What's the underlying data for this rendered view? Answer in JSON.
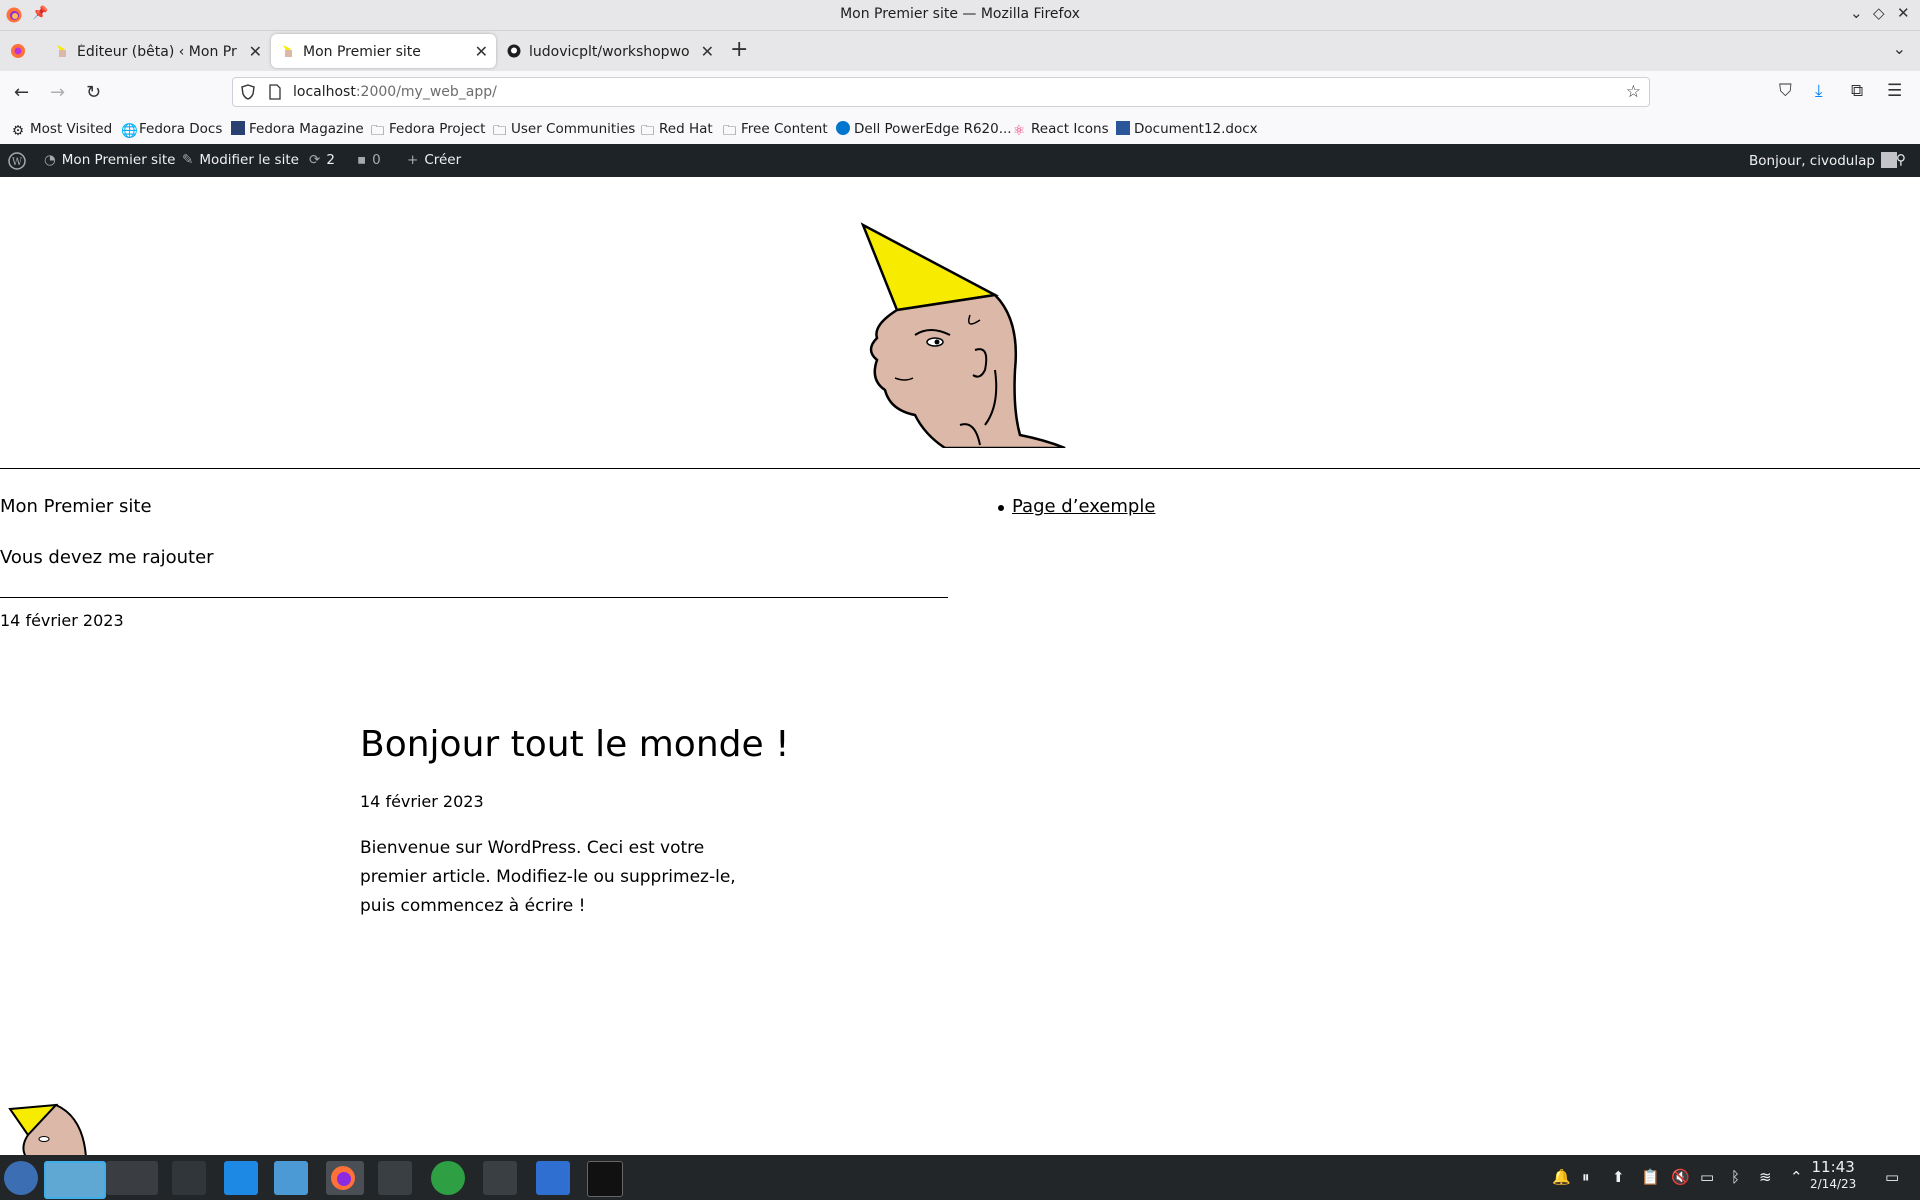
{
  "window": {
    "title": "Mon Premier site — Mozilla Firefox",
    "pin_icon": "pin-icon",
    "controls": [
      "minimize-icon",
      "maximize-icon",
      "close-icon"
    ]
  },
  "tabs": [
    {
      "label": "Éditeur (bêta) ‹ Mon Premi",
      "close": "✕",
      "active": false
    },
    {
      "label": "Mon Premier site",
      "close": "✕",
      "active": true
    },
    {
      "label": "ludovicplt/workshopwordp",
      "close": "✕",
      "active": false
    }
  ],
  "tabbar": {
    "new_tab": "+",
    "list_all": "⌄"
  },
  "navbar": {
    "url_host": "localhost",
    "url_path": ":2000/my_web_app/"
  },
  "bookmarks": [
    {
      "label": "Most Visited",
      "icon": "gear-icon"
    },
    {
      "label": "Fedora Docs",
      "icon": "globe-icon"
    },
    {
      "label": "Fedora Magazine",
      "icon": "fedora-magazine-icon"
    },
    {
      "label": "Fedora Project",
      "icon": "folder-icon"
    },
    {
      "label": "User Communities",
      "icon": "folder-icon"
    },
    {
      "label": "Red Hat",
      "icon": "folder-icon"
    },
    {
      "label": "Free Content",
      "icon": "folder-icon"
    },
    {
      "label": "Dell PowerEdge R620...",
      "icon": "dell-icon"
    },
    {
      "label": "React Icons",
      "icon": "react-icon"
    },
    {
      "label": "Document12.docx",
      "icon": "word-icon"
    }
  ],
  "wpbar": {
    "site_name": "Mon Premier site",
    "edit_site": "Modifier le site",
    "updates_count": "2",
    "comments_count": "0",
    "new_label": "Créer",
    "greeting": "Bonjour, civodulap"
  },
  "site": {
    "title": "Mon Premier site",
    "tagline": "Vous devez me rajouter",
    "header_date": "14 février 2023",
    "menu": [
      "Page d’exemple"
    ]
  },
  "post": {
    "title": "Bonjour tout le monde !",
    "date": "14 février 2023",
    "excerpt": "Bienvenue sur WordPress. Ceci est votre premier article. Modifiez-le ou supprimez-le, puis commencez à écrire !"
  },
  "taskbar": {
    "time": "11:43",
    "date": "2/14/23"
  },
  "colors": {
    "wpbar_bg": "#1d2327",
    "taskbar_bg": "#232629",
    "cone_yellow": "#f7ec00",
    "skin": "#dcb8a8"
  }
}
